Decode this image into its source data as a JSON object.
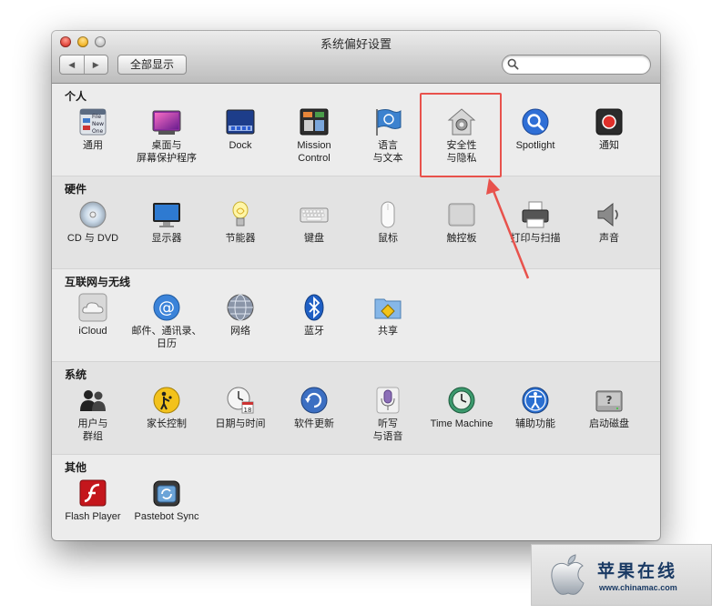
{
  "window": {
    "title": "系统偏好设置"
  },
  "toolbar": {
    "back": "◀",
    "forward": "▶",
    "show_all": "全部显示",
    "search_placeholder": ""
  },
  "sections": [
    {
      "title": "个人",
      "items": [
        {
          "line1": "通用",
          "icon": "general-icon"
        },
        {
          "line1": "桌面与",
          "line2": "屏幕保护程序",
          "icon": "desktop-icon"
        },
        {
          "line1": "Dock",
          "icon": "dock-icon"
        },
        {
          "line1": "Mission",
          "line2": "Control",
          "icon": "mission-control-icon"
        },
        {
          "line1": "语言",
          "line2": "与文本",
          "icon": "language-flag-icon"
        },
        {
          "line1": "安全性",
          "line2": "与隐私",
          "icon": "security-house-icon"
        },
        {
          "line1": "Spotlight",
          "icon": "spotlight-magnifier-icon"
        },
        {
          "line1": "通知",
          "icon": "notification-icon"
        }
      ]
    },
    {
      "title": "硬件",
      "items": [
        {
          "line1": "CD 与 DVD",
          "icon": "cd-icon"
        },
        {
          "line1": "显示器",
          "icon": "display-icon"
        },
        {
          "line1": "节能器",
          "icon": "bulb-icon"
        },
        {
          "line1": "键盘",
          "icon": "keyboard-icon"
        },
        {
          "line1": "鼠标",
          "icon": "mouse-icon"
        },
        {
          "line1": "触控板",
          "icon": "trackpad-icon"
        },
        {
          "line1": "打印与扫描",
          "icon": "printer-icon"
        },
        {
          "line1": "声音",
          "icon": "speaker-icon"
        }
      ]
    },
    {
      "title": "互联网与无线",
      "items": [
        {
          "line1": "iCloud",
          "icon": "icloud-icon"
        },
        {
          "line1": "邮件、通讯录、",
          "line2": "日历",
          "icon": "mail-at-icon"
        },
        {
          "line1": "网络",
          "icon": "network-globe-icon"
        },
        {
          "line1": "蓝牙",
          "icon": "bluetooth-icon"
        },
        {
          "line1": "共享",
          "icon": "sharing-folder-icon"
        }
      ]
    },
    {
      "title": "系统",
      "items": [
        {
          "line1": "用户与",
          "line2": "群组",
          "icon": "users-icon"
        },
        {
          "line1": "家长控制",
          "icon": "parental-controls-icon"
        },
        {
          "line1": "日期与时间",
          "icon": "clock-calendar-icon"
        },
        {
          "line1": "软件更新",
          "icon": "software-update-icon"
        },
        {
          "line1": "听写",
          "line2": "与语音",
          "icon": "microphone-icon"
        },
        {
          "line1": "Time Machine",
          "icon": "time-machine-icon"
        },
        {
          "line1": "辅助功能",
          "icon": "accessibility-icon"
        },
        {
          "line1": "启动磁盘",
          "icon": "startup-disk-icon"
        }
      ]
    },
    {
      "title": "其他",
      "items": [
        {
          "line1": "Flash Player",
          "icon": "flash-icon"
        },
        {
          "line1": "Pastebot Sync",
          "icon": "pastebot-icon"
        }
      ]
    }
  ],
  "general_icon_text": {
    "a": "File",
    "b": "New",
    "c": "One"
  },
  "calendar_day": "18",
  "watermark": {
    "title": "苹果在线",
    "url": "www.chinamac.com"
  },
  "colors": {
    "highlight": "#e8524c",
    "brand": "#1a3a64"
  }
}
